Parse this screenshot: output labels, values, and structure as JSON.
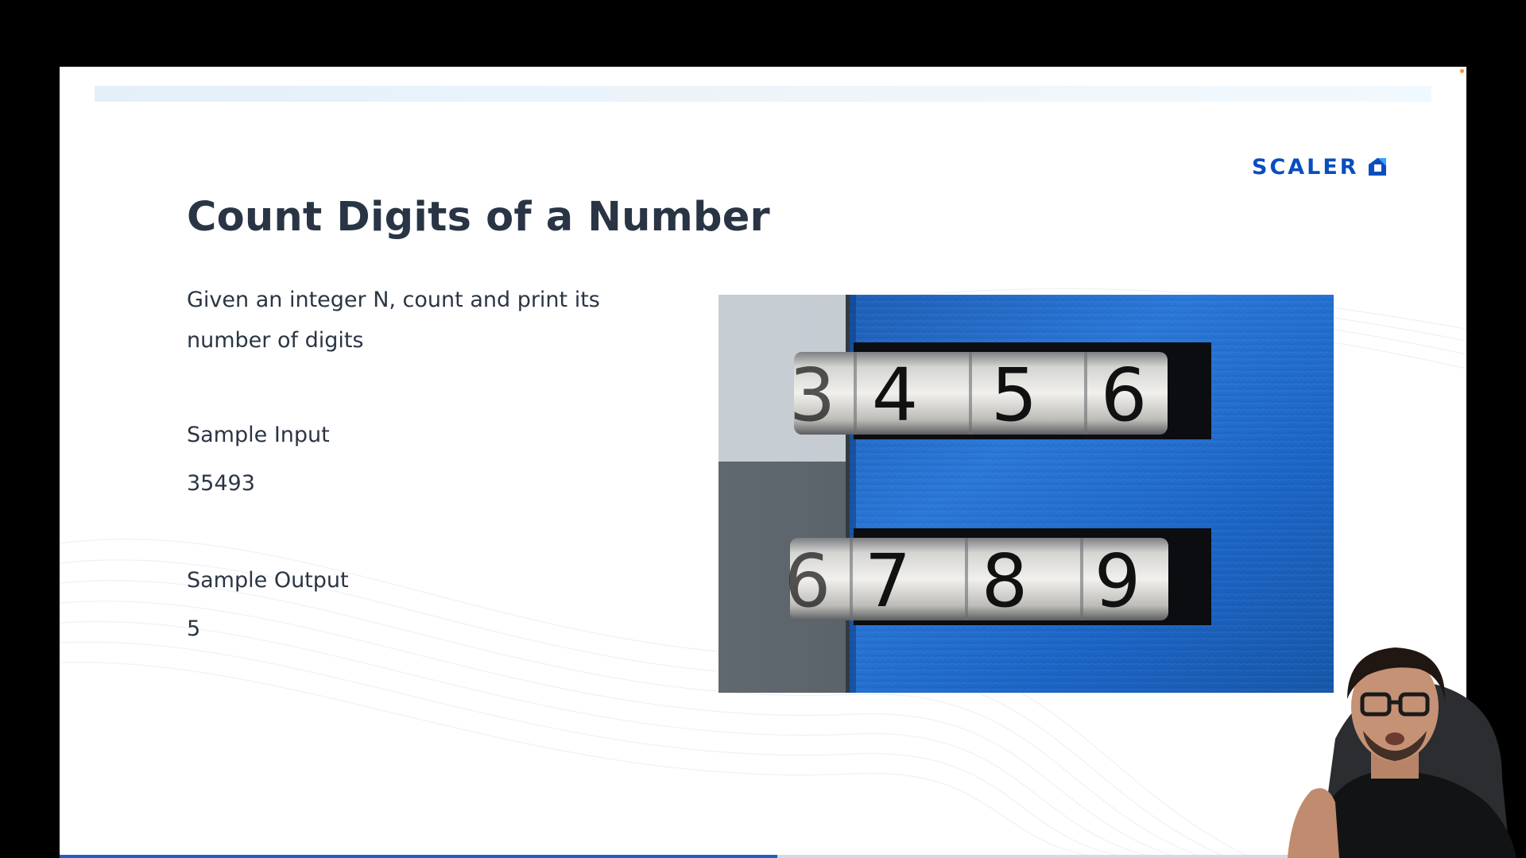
{
  "brand": {
    "name": "SCALER",
    "icon": "scaler-logo-icon",
    "color": "#0a4dbf"
  },
  "slide": {
    "title": "Count Digits of a Number",
    "description": "Given an integer N, count and print its number of digits",
    "sample_input_label": "Sample Input",
    "sample_input_value": "35493",
    "sample_output_label": "Sample Output",
    "sample_output_value": "5"
  },
  "photo": {
    "subject": "combination lock dials",
    "top_row_digits": [
      "3",
      "4",
      "5",
      "6"
    ],
    "bottom_row_digits": [
      "6",
      "7",
      "8",
      "9"
    ]
  },
  "video": {
    "progress_percent": 51,
    "accent_color": "#1d5ec9"
  }
}
